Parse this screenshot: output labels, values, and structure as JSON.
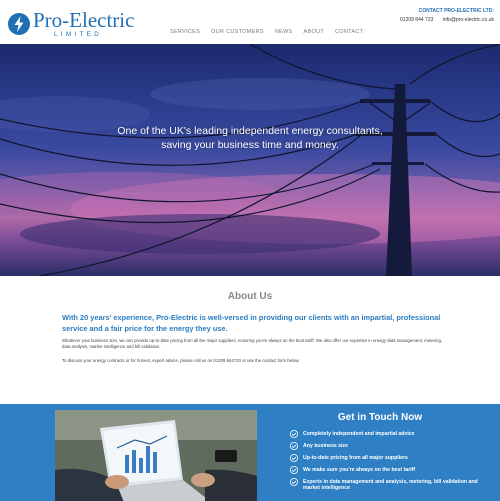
{
  "header": {
    "logo": {
      "name": "Pro-Electric",
      "sub": "LIMITED"
    },
    "nav": [
      {
        "label": "SERVICES"
      },
      {
        "label": "OUR CUSTOMERS"
      },
      {
        "label": "NEWS"
      },
      {
        "label": "ABOUT"
      },
      {
        "label": "CONTACT"
      }
    ],
    "contact": {
      "title": "CONTACT PRO-ELECTRIC LTD:",
      "phone": "01209 844 723",
      "email": "info@pro-electric.co.uk"
    }
  },
  "hero": {
    "line1": "One of the UK's leading independent energy consultants,",
    "line2": "saving your business time and money."
  },
  "about": {
    "heading": "About Us",
    "lead": "With 20 years' experience, Pro-Electric is well-versed in providing our clients with an impartial, professional service and a fair price for the energy they use.",
    "para1": "Whatever your business size, we can provide up-to-date pricing from all the major suppliers, ensuring you're always on the best tariff. We also offer our expertise in energy data management, metering, data analysis, market intelligence and bill validation.",
    "para2": "To discuss your energy contracts or for honest, expert advice, please call us on 01209 844723 or use the contact form below."
  },
  "touch": {
    "heading": "Get in Touch Now",
    "items": [
      {
        "label": "Completely independent and impartial advice"
      },
      {
        "label": "Any business size"
      },
      {
        "label": "Up-to-date pricing from all major suppliers"
      },
      {
        "label": "We make sure you're always on the best tariff"
      },
      {
        "label": "Experts in data management and analysis, metering, bill validation and market intelligence"
      }
    ]
  },
  "colors": {
    "brand": "#1f6fb2",
    "lead_text": "#2a7dc2",
    "touch_bg": "#2e7fc4"
  },
  "icons": {
    "logo": "lightning-bolt-icon",
    "check": "check-circle-icon"
  }
}
